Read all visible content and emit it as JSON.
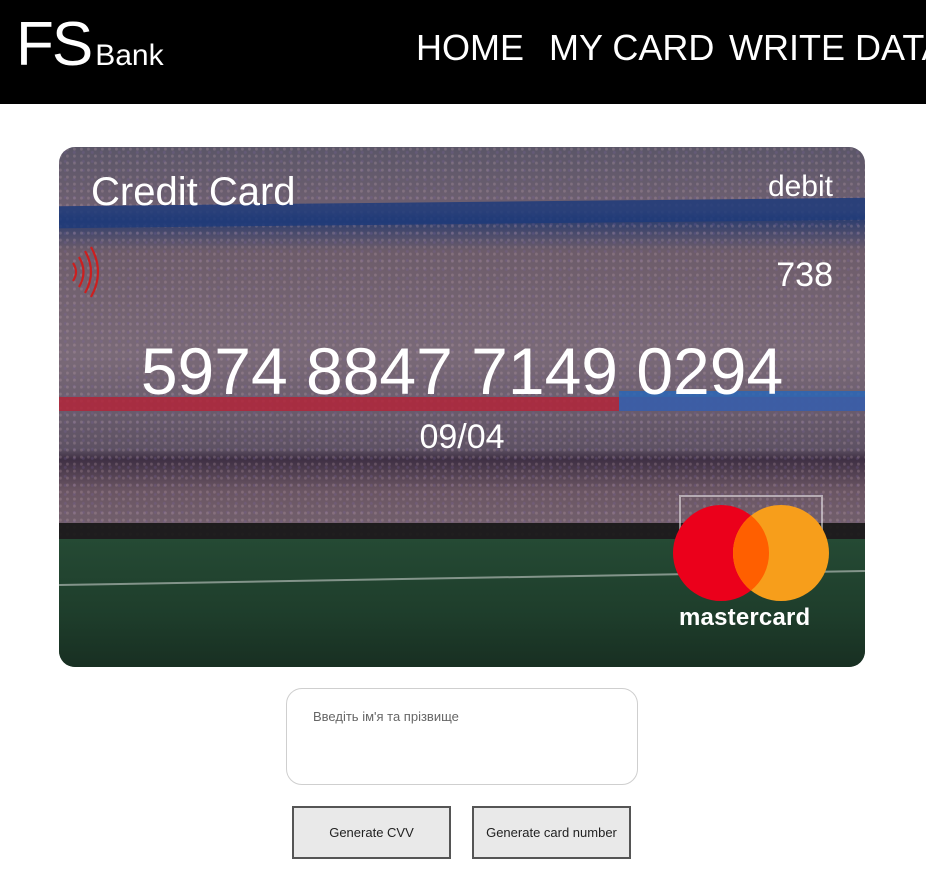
{
  "header": {
    "logo_main": "FS",
    "logo_sub": "Bank",
    "nav": [
      "HOME",
      "MY CARD",
      "WRITE DATA"
    ]
  },
  "card": {
    "title": "Credit Card",
    "type": "debit",
    "cvv": "738",
    "number": "5974 8847 7149 0294",
    "expiry": "09/04",
    "brand": "mastercard",
    "icons": [
      "nfc-contactless-icon",
      "mastercard-logo-icon"
    ]
  },
  "form": {
    "name_placeholder": "Введіть ім'я та прізвище",
    "name_value": "",
    "generate_cvv_label": "Generate CVV",
    "generate_number_label": "Generate card number"
  },
  "colors": {
    "header_bg": "#000000",
    "mastercard_red": "#eb001b",
    "mastercard_orange": "#f79e1b",
    "mastercard_overlap": "#ff5f00",
    "nfc_red": "#cc1f1f"
  }
}
